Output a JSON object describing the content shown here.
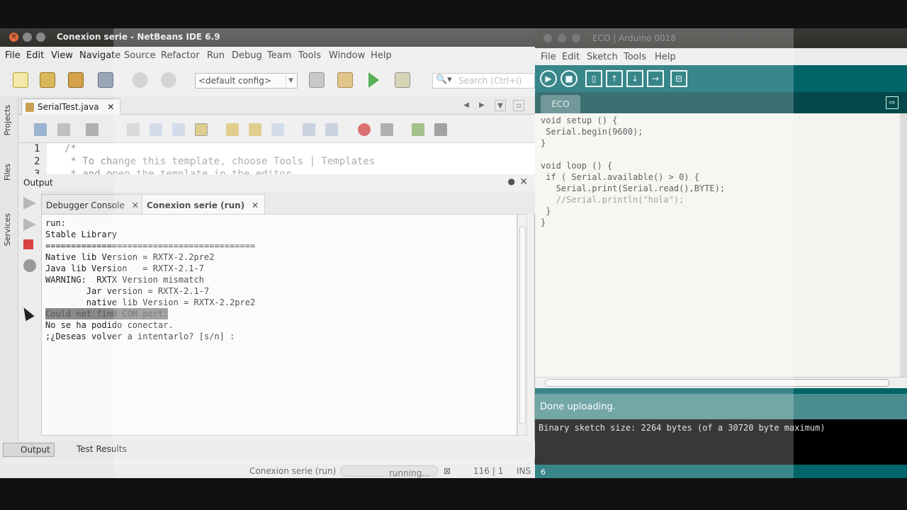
{
  "netbeans": {
    "title": "Conexion serie - NetBeans IDE 6.9",
    "menu": [
      "File",
      "Edit",
      "View",
      "Navigate",
      "Source",
      "Refactor",
      "Run",
      "Debug",
      "Team",
      "Tools",
      "Window",
      "Help"
    ],
    "config_select": "<default config>",
    "search_placeholder": "Search (Ctrl+I)",
    "side_tabs": [
      "Projects",
      "Files",
      "Services"
    ],
    "editor_tab": "SerialTest.java",
    "editor_lines": [
      {
        "num": "1",
        "text": "/*"
      },
      {
        "num": "2",
        "text": " * To change this template, choose Tools | Templates"
      },
      {
        "num": "3",
        "text": " * and open the template in the editor."
      }
    ],
    "output": {
      "title": "Output",
      "tabs": [
        "Debugger Console",
        "Conexion serie (run)"
      ],
      "lines": [
        "run:",
        "Stable Library",
        "=========================================",
        "Native lib Version = RXTX-2.2pre2",
        "Java lib Version   = RXTX-2.1-7",
        "WARNING:  RXTX Version mismatch",
        "        Jar version = RXTX-2.1-7",
        "        native lib Version = RXTX-2.2pre2",
        "Could not find COM port.",
        "No se ha podido conectar.",
        ";¿Deseas volver a intentarlo? [s/n] :"
      ]
    },
    "bottom_tabs": [
      "Output",
      "Test Results"
    ],
    "status": {
      "task": "Conexion serie (run)",
      "progress": "running...",
      "position": "116 | 1",
      "mode": "INS"
    }
  },
  "arduino": {
    "title": "ECO | Arduino 0018",
    "menu": [
      "File",
      "Edit",
      "Sketch",
      "Tools",
      "Help"
    ],
    "tab": "ECO",
    "code_lines": [
      "void setup () {",
      " Serial.begin(9600);",
      "}",
      "",
      "void loop () {",
      " if ( Serial.available() > 0) {",
      "   Serial.print(Serial.read(),BYTE);",
      "   //Serial.println(\"hola\");",
      " }",
      "}"
    ],
    "status_message": "Done uploading.",
    "console": "Binary sketch size: 2264 bytes (of a 30720 byte maximum)",
    "line_number": "6"
  }
}
